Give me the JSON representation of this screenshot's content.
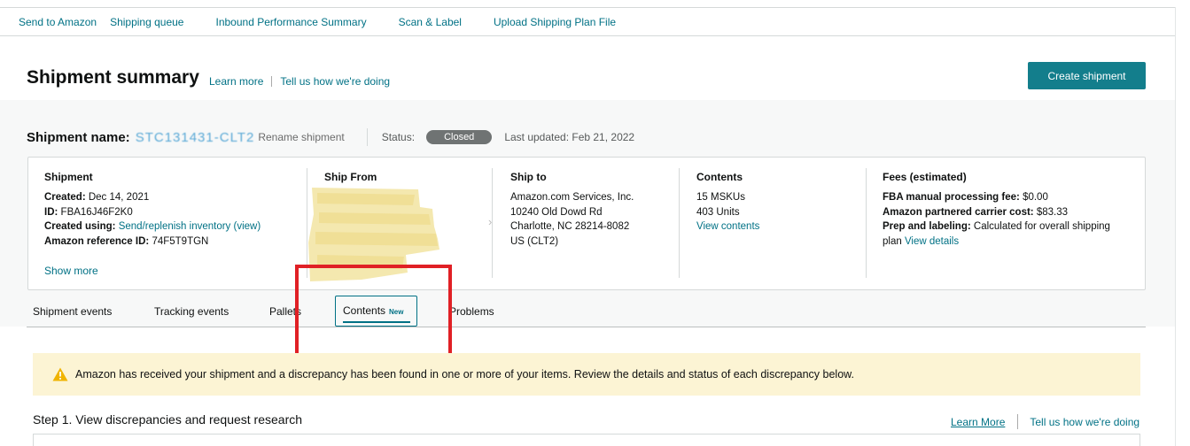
{
  "topnav": {
    "items": [
      "Send to Amazon",
      "Shipping queue",
      "Inbound Performance Summary",
      "Scan & Label",
      "Upload Shipping Plan File"
    ]
  },
  "header": {
    "title": "Shipment summary",
    "learn_more": "Learn more",
    "feedback": "Tell us how we're doing",
    "create_button": "Create shipment"
  },
  "shipment": {
    "name_label": "Shipment name:",
    "name_value": "STC131431-CLT2",
    "rename": "Rename shipment",
    "status_label": "Status:",
    "status_value": "Closed",
    "last_updated": "Last updated: Feb 21, 2022"
  },
  "card": {
    "shipment": {
      "heading": "Shipment",
      "created_label": "Created:",
      "created_value": "Dec 14, 2021",
      "id_label": "ID:",
      "id_value": "FBA16J46F2K0",
      "created_using_label": "Created using:",
      "created_using_value": "Send/replenish inventory (view)",
      "ref_label": "Amazon reference ID:",
      "ref_value": "74F5T9TGN",
      "show_more": "Show more"
    },
    "ship_from": {
      "heading": "Ship From"
    },
    "ship_to": {
      "heading": "Ship to",
      "line1": "Amazon.com Services, Inc.",
      "line2": "10240 Old Dowd Rd",
      "line3": "Charlotte, NC 28214-8082",
      "line4": "US (CLT2)"
    },
    "contents": {
      "heading": "Contents",
      "mskus": "15 MSKUs",
      "units": "403 Units",
      "view": "View contents"
    },
    "fees": {
      "heading": "Fees (estimated)",
      "fba_label": "FBA manual processing fee:",
      "fba_value": "$0.00",
      "carrier_label": "Amazon partnered carrier cost:",
      "carrier_value": "$83.33",
      "prep_label": "Prep and labeling:",
      "prep_value": "Calculated for overall shipping",
      "prep_value2": "plan",
      "view_details": "View details"
    }
  },
  "tabs": {
    "shipment_events": "Shipment events",
    "tracking_events": "Tracking events",
    "pallets": "Pallets",
    "contents": "Contents",
    "contents_badge": "New",
    "problems": "Problems"
  },
  "alert": {
    "message": "Amazon has received your shipment and a discrepancy has been found in one or more of your items. Review the details and status of each discrepancy below."
  },
  "step": {
    "title": "Step 1. View discrepancies and request research",
    "learn_more": "Learn More",
    "feedback": "Tell us how we're doing"
  },
  "colors": {
    "accent": "#137e8c",
    "link": "#007185",
    "status_pill": "#6f7373",
    "alert_bg": "#fcf4d4",
    "annotation_red": "#e02025"
  }
}
